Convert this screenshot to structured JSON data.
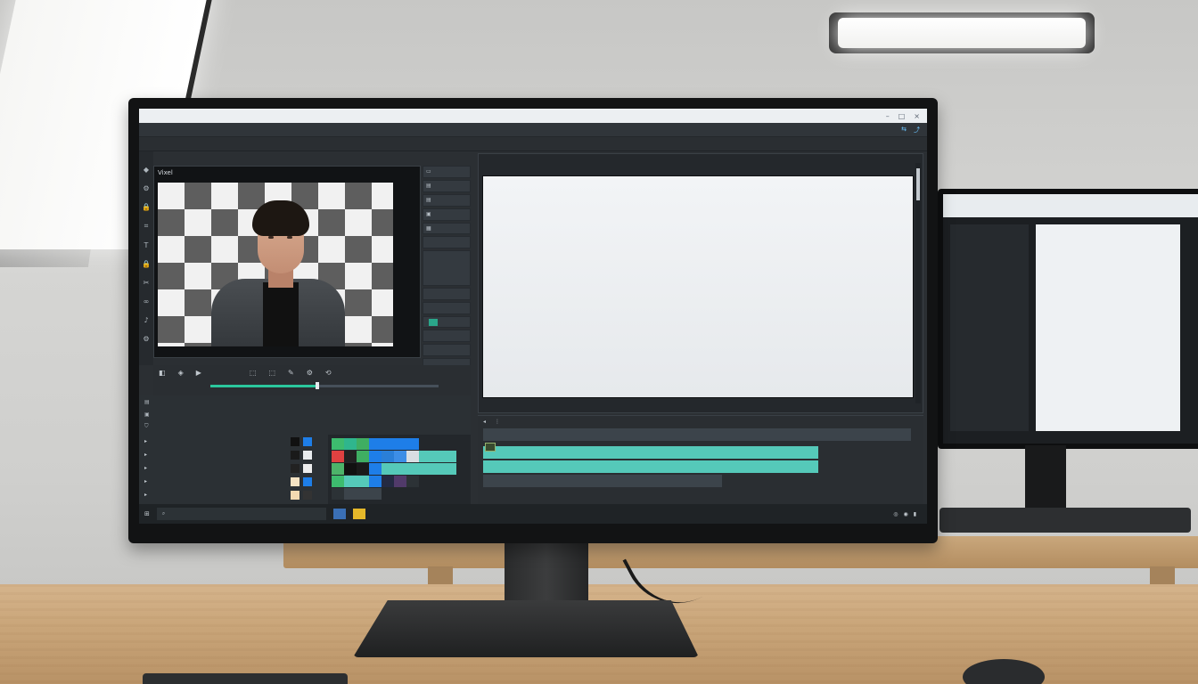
{
  "window": {
    "title": "",
    "controls": [
      "–",
      "□",
      "×"
    ]
  },
  "menus": [
    "",
    "",
    "",
    "",
    "",
    "",
    "",
    "",
    "",
    ""
  ],
  "toolbar": [
    "",
    "",
    "",
    "",
    "",
    "",
    "",
    "",
    ""
  ],
  "source_viewer": {
    "label": "Vixel",
    "timecode": "",
    "progress": 0.47
  },
  "right_tools": [
    "",
    "",
    "",
    "",
    "",
    "",
    "",
    "",
    "",
    "",
    "",
    "",
    "",
    "",
    ""
  ],
  "program": {
    "tabs": [
      "",
      "",
      ""
    ],
    "footer_left": "",
    "footer_mid": "",
    "footer_right": ""
  },
  "bin": {
    "items": [
      "",
      "",
      "",
      "",
      "",
      ""
    ]
  },
  "taskbar": {
    "search": "",
    "clock": ""
  },
  "colors": {
    "accent": "#2bc79d",
    "track": "#55c9b9",
    "panel": "#2b2f33",
    "blue": "#1e7ee8"
  }
}
